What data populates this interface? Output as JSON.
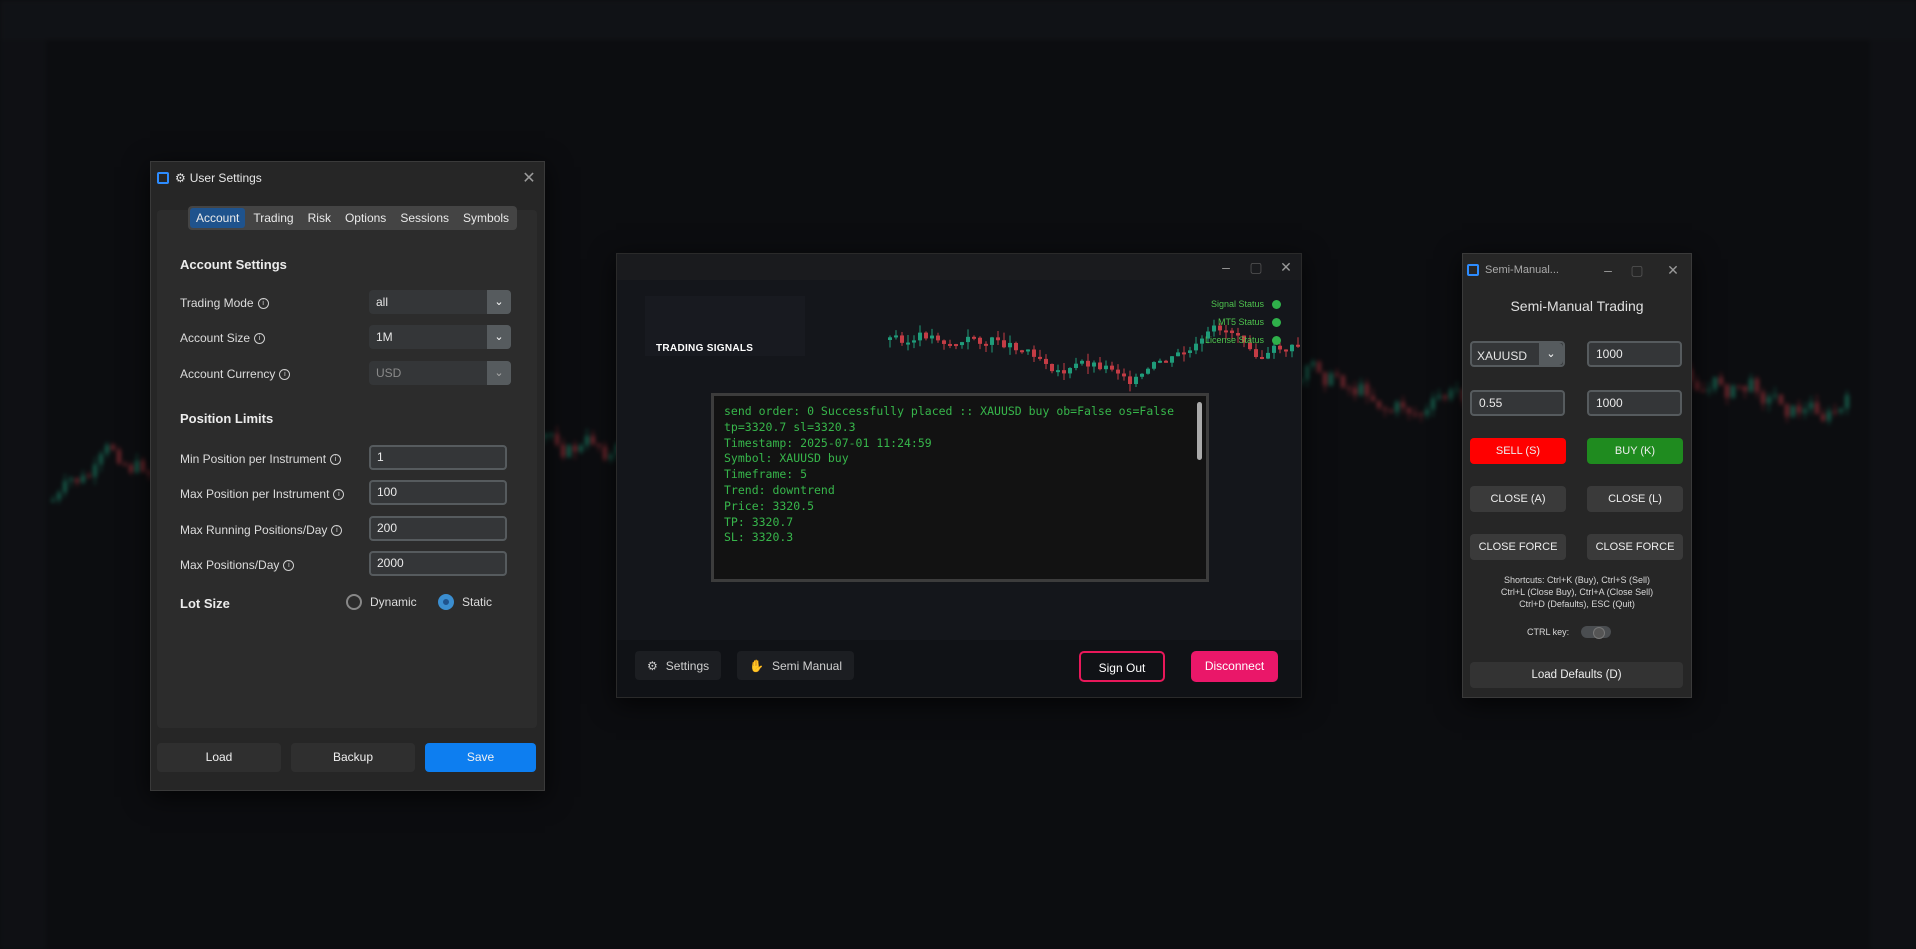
{
  "settings": {
    "title": "User Settings",
    "tabs": [
      "Account",
      "Trading",
      "Risk",
      "Options",
      "Sessions",
      "Symbols"
    ],
    "account_section": "Account Settings",
    "trading_mode_label": "Trading Mode",
    "trading_mode_value": "all",
    "account_size_label": "Account Size",
    "account_size_value": "1M",
    "account_currency_label": "Account Currency",
    "account_currency_value": "USD",
    "position_section": "Position Limits",
    "min_pos_label": "Min Position per Instrument",
    "min_pos_value": "1",
    "max_pos_label": "Max Position per Instrument",
    "max_pos_value": "100",
    "max_running_label": "Max Running Positions/Day",
    "max_running_value": "200",
    "max_day_label": "Max Positions/Day",
    "max_day_value": "2000",
    "lot_section": "Lot Size",
    "lot_dynamic": "Dynamic",
    "lot_static": "Static",
    "load": "Load",
    "backup": "Backup",
    "save": "Save"
  },
  "signals": {
    "title": "TRADING SIGNALS",
    "status": [
      "Signal Status",
      "MT5 Status",
      "License Status"
    ],
    "console_lines": [
      "send order: 0 Successfully placed :: XAUUSD buy ob=False os=False",
      "tp=3320.7 sl=3320.3",
      "",
      "Timestamp: 2025-07-01 11:24:59",
      "Symbol: XAUUSD buy",
      "Timeframe: 5",
      "Trend: downtrend",
      "Price: 3320.5",
      "TP: 3320.7",
      "SL: 3320.3"
    ],
    "settings_btn": "Settings",
    "semi_btn": "Semi Manual",
    "signout": "Sign Out",
    "disconnect": "Disconnect"
  },
  "semi": {
    "title": "Semi-Manual...",
    "heading": "Semi-Manual Trading",
    "symbol": "XAUUSD",
    "field1": "1000",
    "field2": "0.55",
    "field3": "1000",
    "sell": "SELL (S)",
    "buy": "BUY (K)",
    "close_a": "CLOSE (A)",
    "close_l": "CLOSE (L)",
    "close_force_1": "CLOSE FORCE",
    "close_force_2": "CLOSE FORCE",
    "shortcuts_1": "Shortcuts: Ctrl+K (Buy), Ctrl+S (Sell)",
    "shortcuts_2": "Ctrl+L (Close Buy), Ctrl+A (Close Sell)",
    "shortcuts_3": "Ctrl+D (Defaults), ESC (Quit)",
    "ctrl_key": "CTRL key:",
    "load_defaults": "Load Defaults (D)"
  },
  "colors": {
    "accent_blue": "#1f6aa5",
    "save_blue": "#0d7ef0",
    "sell_red": "#ff0000",
    "buy_green": "#1f8b1f",
    "disconnect_pink": "#ea1769",
    "console_green": "#37b64b"
  }
}
